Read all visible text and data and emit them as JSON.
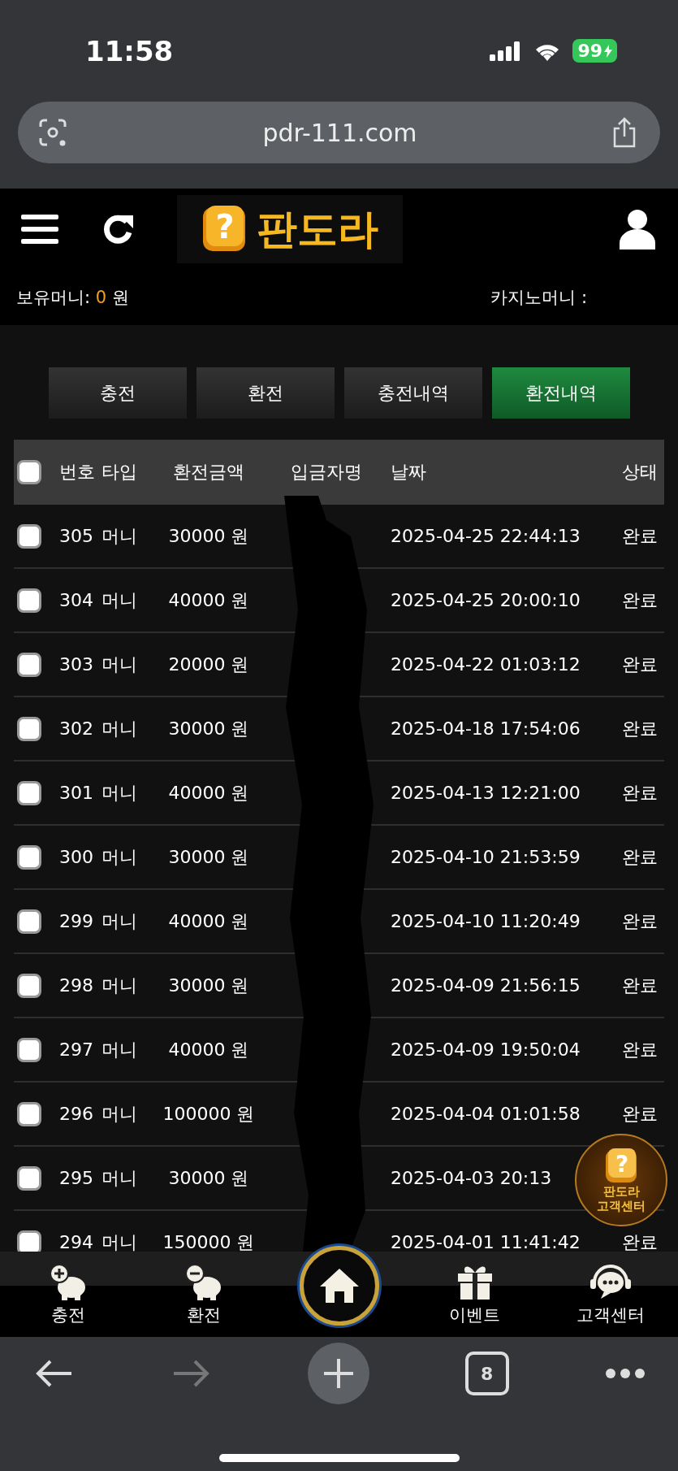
{
  "status_bar": {
    "time": "11:58",
    "battery": "99"
  },
  "browser": {
    "url": "pdr-111.com",
    "tab_count": "8"
  },
  "header": {
    "logo_mark": "?",
    "logo_text": "판도라",
    "balance_label": "보유머니:",
    "balance_value": "0",
    "balance_unit": "원",
    "casino_label": "카지노머니 :"
  },
  "tabs": [
    {
      "label": "충전",
      "selected": false
    },
    {
      "label": "환전",
      "selected": false
    },
    {
      "label": "충전내역",
      "selected": false
    },
    {
      "label": "환전내역",
      "selected": true
    }
  ],
  "table": {
    "header_checked": false,
    "columns": [
      "번호",
      "타입",
      "환전금액",
      "입금자명",
      "날짜",
      "상태"
    ],
    "rows": [
      {
        "checked": false,
        "no": "305",
        "type": "머니",
        "amount": "30000 원",
        "date": "2025-04-25 22:44:13",
        "status": "완료"
      },
      {
        "checked": false,
        "no": "304",
        "type": "머니",
        "amount": "40000 원",
        "date": "2025-04-25 20:00:10",
        "status": "완료"
      },
      {
        "checked": false,
        "no": "303",
        "type": "머니",
        "amount": "20000 원",
        "date": "2025-04-22 01:03:12",
        "status": "완료"
      },
      {
        "checked": false,
        "no": "302",
        "type": "머니",
        "amount": "30000 원",
        "date": "2025-04-18 17:54:06",
        "status": "완료"
      },
      {
        "checked": false,
        "no": "301",
        "type": "머니",
        "amount": "40000 원",
        "date": "2025-04-13 12:21:00",
        "status": "완료"
      },
      {
        "checked": false,
        "no": "300",
        "type": "머니",
        "amount": "30000 원",
        "date": "2025-04-10 21:53:59",
        "status": "완료"
      },
      {
        "checked": false,
        "no": "299",
        "type": "머니",
        "amount": "40000 원",
        "date": "2025-04-10 11:20:49",
        "status": "완료"
      },
      {
        "checked": false,
        "no": "298",
        "type": "머니",
        "amount": "30000 원",
        "date": "2025-04-09 21:56:15",
        "status": "완료"
      },
      {
        "checked": false,
        "no": "297",
        "type": "머니",
        "amount": "40000 원",
        "date": "2025-04-09 19:50:04",
        "status": "완료"
      },
      {
        "checked": false,
        "no": "296",
        "type": "머니",
        "amount": "100000 원",
        "date": "2025-04-04 01:01:58",
        "status": "완료"
      },
      {
        "checked": false,
        "no": "295",
        "type": "머니",
        "amount": "30000 원",
        "date": "2025-04-03 20:13"
      },
      {
        "checked": false,
        "no": "294",
        "type": "머니",
        "amount": "150000 원",
        "date": "2025-04-01 11:41:42",
        "status": "완료"
      }
    ]
  },
  "floating_button": {
    "mark": "?",
    "logo_text": "판도라",
    "label": "고객센터"
  },
  "bottom_nav": [
    {
      "kind": "deposit",
      "label": "충전"
    },
    {
      "kind": "withdraw",
      "label": "환전"
    },
    {
      "kind": "home"
    },
    {
      "kind": "event",
      "label": "이벤트"
    },
    {
      "kind": "support",
      "label": "고객센터"
    }
  ]
}
